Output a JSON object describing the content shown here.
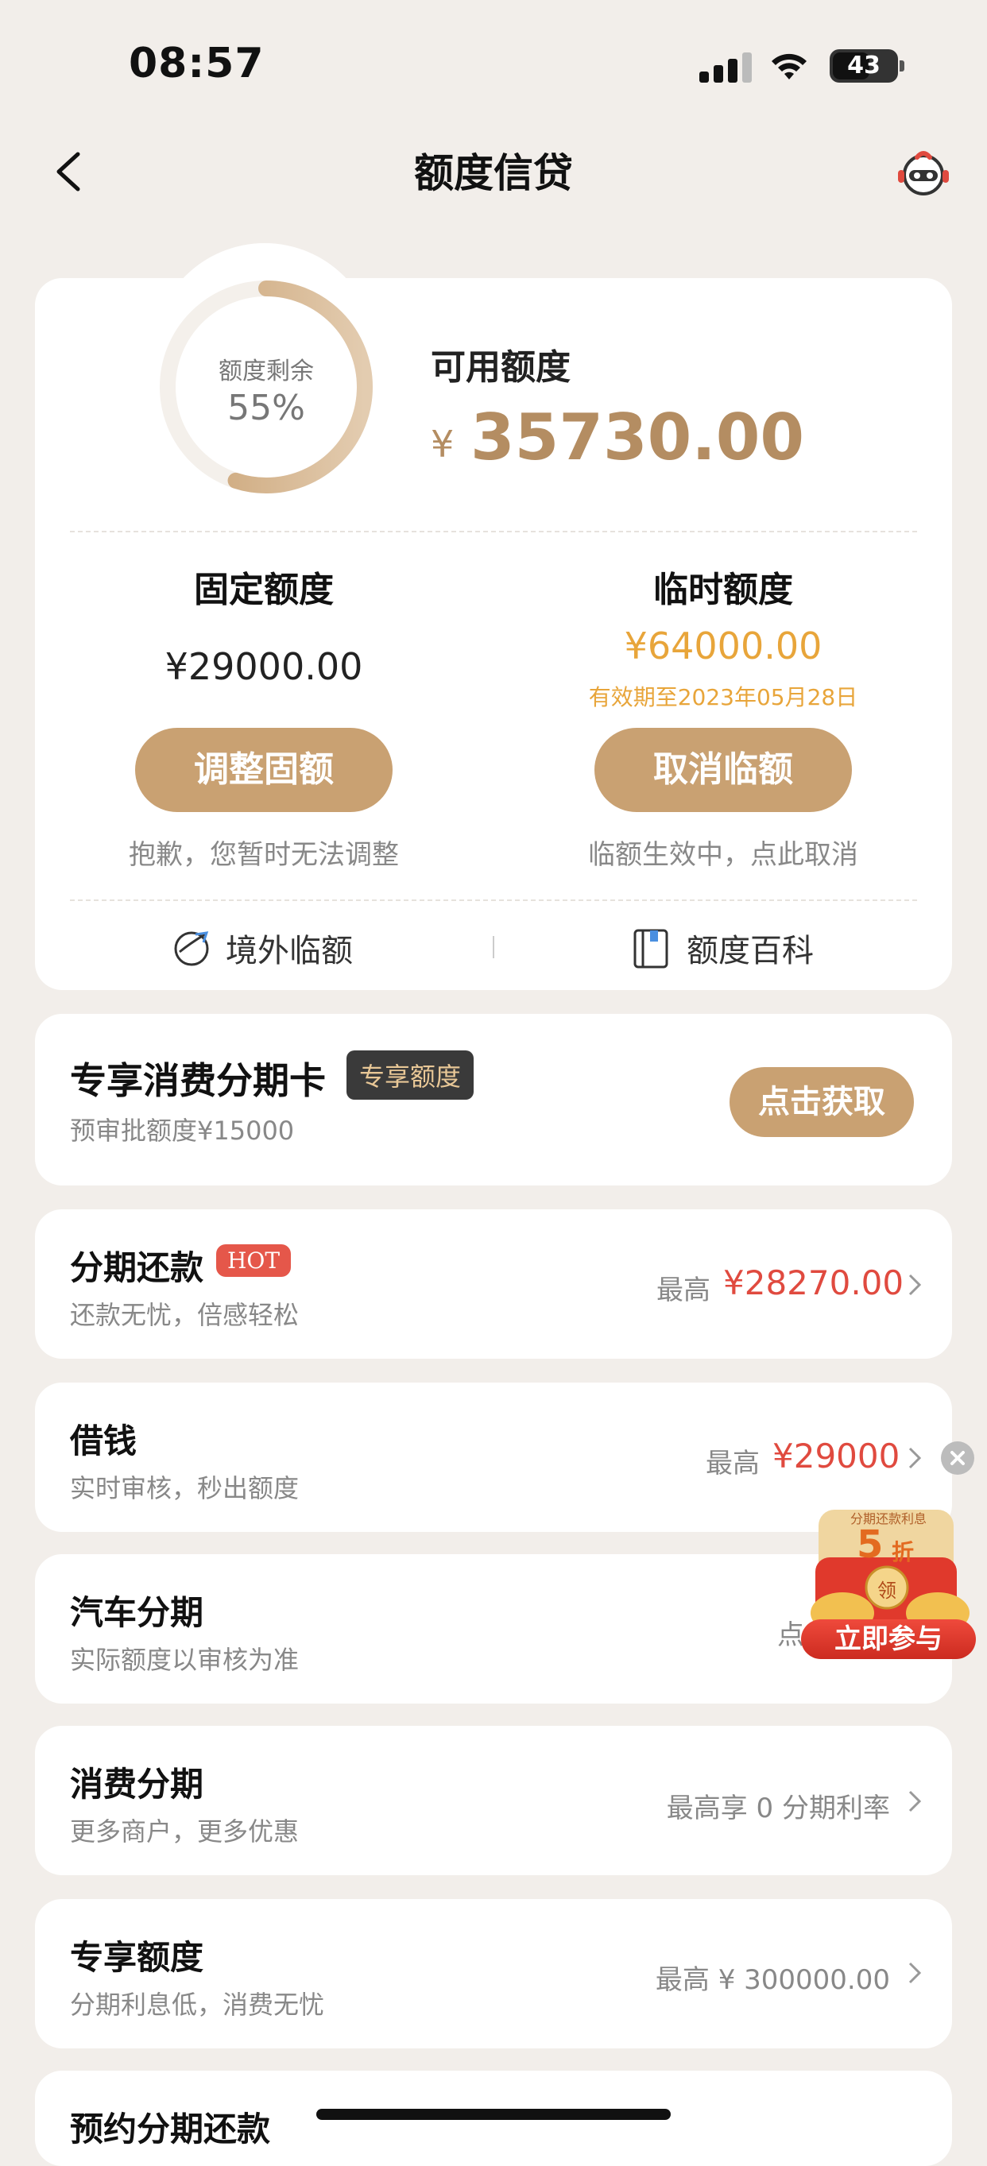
{
  "status_bar": {
    "time": "08:57",
    "battery": "43"
  },
  "nav": {
    "title": "额度信贷"
  },
  "credit": {
    "ring_label": "额度剩余",
    "ring_percent_text": "55%",
    "ring_fraction": 0.55,
    "available_label": "可用额度",
    "currency": "¥",
    "available_amount": "35730.00",
    "fixed": {
      "title": "固定额度",
      "amount": "¥29000.00",
      "button": "调整固额",
      "note": "抱歉，您暂时无法调整"
    },
    "temporary": {
      "title": "临时额度",
      "amount": "¥64000.00",
      "validity": "有效期至2023年05月28日",
      "button": "取消临额",
      "note": "临额生效中，点此取消"
    },
    "links": {
      "overseas": "境外临额",
      "encyclopedia": "额度百科"
    }
  },
  "exclusive_card": {
    "title": "专享消费分期卡",
    "tag": "专享额度",
    "subtitle": "预审批额度¥15000",
    "button": "点击获取"
  },
  "rows": [
    {
      "title": "分期还款",
      "badge": "HOT",
      "subtitle": "还款无忧，倍感轻松",
      "prefix": "最高",
      "value": "¥28270.00"
    },
    {
      "title": "借钱",
      "subtitle": "实时审核，秒出额度",
      "prefix": "最高",
      "value": "¥29000"
    },
    {
      "title": "汽车分期",
      "subtitle": "实际额度以审核为准",
      "right_visible": "点"
    },
    {
      "title": "消费分期",
      "subtitle": "更多商户，更多优惠",
      "right": "最高享 0 分期利率"
    },
    {
      "title": "专享额度",
      "subtitle": "分期利息低，消费无忧",
      "right": "最高 ¥ 300000.00"
    },
    {
      "title": "预约分期还款"
    }
  ],
  "promo": {
    "top_text": "分期还款利息",
    "discount": "5",
    "discount_unit": "折",
    "coin_text": "领",
    "button": "立即参与"
  },
  "colors": {
    "accent": "#c9a172",
    "amount": "#b48d62",
    "temp_amount": "#e8a53a",
    "red": "#e04a3f"
  }
}
